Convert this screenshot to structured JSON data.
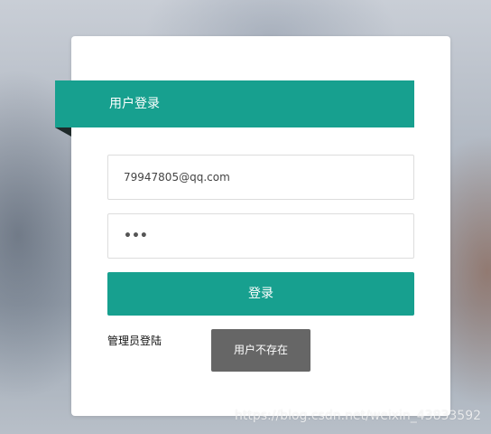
{
  "login_card": {
    "title": "用户登录",
    "email_value": "79947805@qq.com",
    "password_masked": "•••",
    "login_button_label": "登录",
    "admin_link_label": "管理员登陆"
  },
  "toast": {
    "message": "用户不存在"
  },
  "watermark": {
    "text": "https://blog.csdn.net/weixin_43833592"
  },
  "colors": {
    "accent": "#17a08f",
    "toast_background": "#666666",
    "card_background": "#ffffff"
  }
}
